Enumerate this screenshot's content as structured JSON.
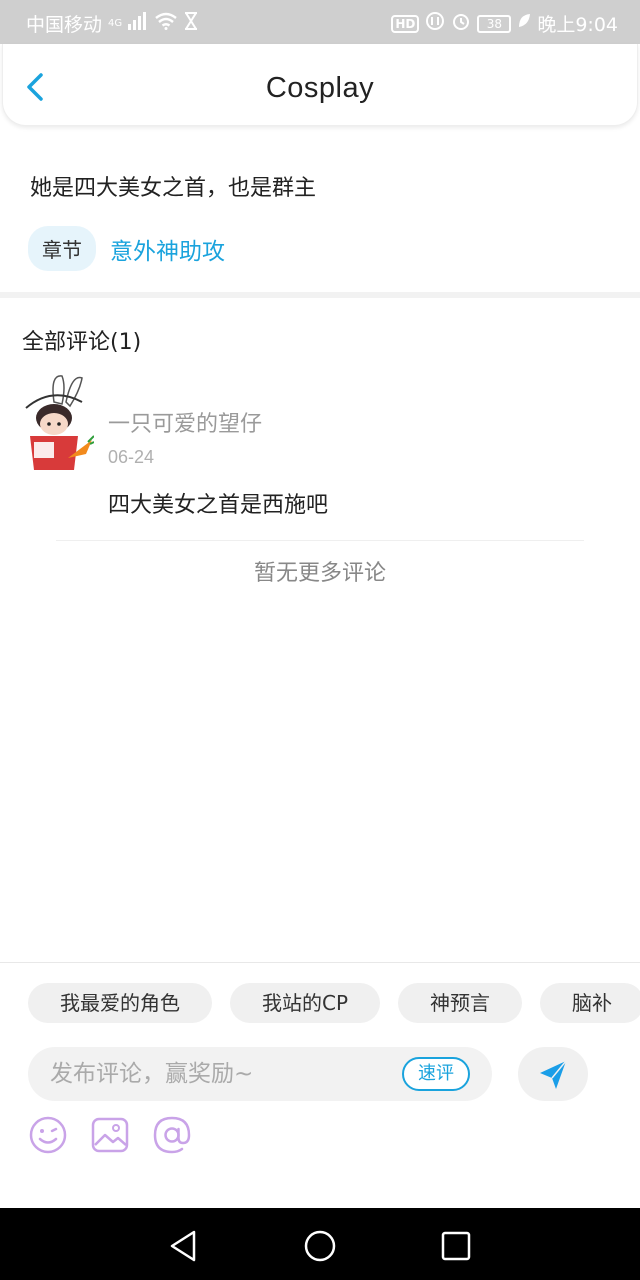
{
  "status_bar": {
    "carrier": "中国移动",
    "network": "4G",
    "hd_label": "HD",
    "battery": "38",
    "time": "晚上9:04"
  },
  "header": {
    "title": "Cosplay"
  },
  "post": {
    "text": "她是四大美女之首，也是群主",
    "chapter_tag": "章节",
    "chapter_link": "意外神助攻"
  },
  "comments": {
    "title": "全部评论(1)",
    "items": [
      {
        "username": "一只可爱的望仔",
        "date": "06-24",
        "text": "四大美女之首是西施吧"
      }
    ],
    "no_more": "暂无更多评论"
  },
  "composer": {
    "chips": [
      "我最爱的角色",
      "我站的CP",
      "神预言",
      "脑补"
    ],
    "placeholder": "发布评论，赢奖励~",
    "quick_label": "速评"
  },
  "colors": {
    "accent": "#1aa3dd",
    "tool_icon": "#c9a3e8",
    "send_icon": "#1a9ee8"
  }
}
